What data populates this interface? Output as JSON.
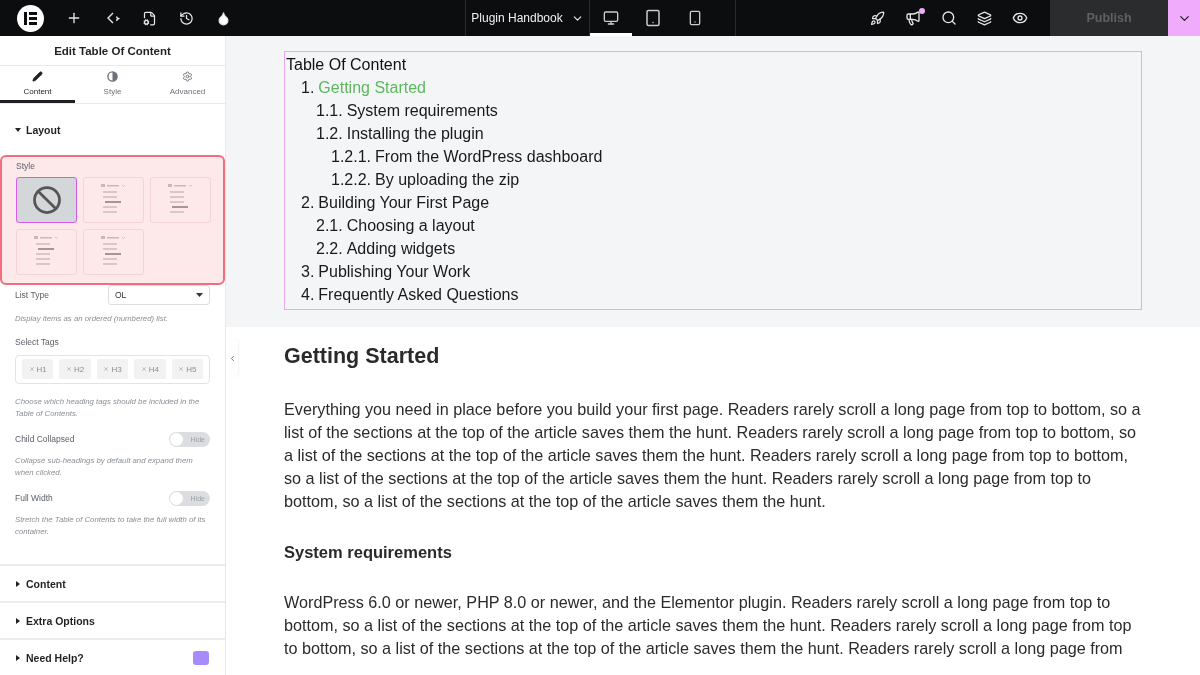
{
  "topbar": {
    "site_name": "Plugin Handbook",
    "devices": [
      {
        "kind": "desktop",
        "selected": true
      },
      {
        "kind": "tablet",
        "selected": false
      },
      {
        "kind": "mobile",
        "selected": false
      }
    ],
    "publish": {
      "label": "Publish",
      "disabled": true
    }
  },
  "panel": {
    "title": "Edit Table Of Content",
    "tabs": [
      {
        "kind": "content",
        "label": "Content",
        "selected": true
      },
      {
        "kind": "style",
        "label": "Style",
        "selected": false
      },
      {
        "kind": "advanced",
        "label": "Advanced",
        "selected": false
      }
    ],
    "layout": {
      "title": "Layout",
      "expanded": true,
      "style_label": "Style",
      "styles": [
        {
          "kind": "none",
          "selected": true
        },
        {
          "kind": "list",
          "selected": false
        },
        {
          "kind": "list",
          "selected": false
        },
        {
          "kind": "list",
          "selected": false
        },
        {
          "kind": "list",
          "selected": false
        }
      ],
      "list_type": {
        "label": "List Type",
        "value": "OL",
        "help": "Display items as an ordered (numbered) list."
      },
      "tags": {
        "label": "Select Tags",
        "items": [
          "H1",
          "H2",
          "H3",
          "H4",
          "H5"
        ],
        "help": "Choose which heading tags should be included in the Table of Contents."
      },
      "toggles": [
        {
          "label": "Child Collapsed",
          "state_label": "Hide",
          "on": false,
          "help": "Collapse sub-headings by default and expand them when clicked."
        },
        {
          "label": "Full Width",
          "state_label": "Hide",
          "on": false,
          "help": "Stretch the Table of Contents to take the full width of its container."
        }
      ]
    },
    "sections": [
      {
        "title": "Content",
        "expanded": false,
        "help_badge": false
      },
      {
        "title": "Extra Options",
        "expanded": false,
        "help_badge": false
      },
      {
        "title": "Need Help?",
        "expanded": false,
        "help_badge": true
      }
    ]
  },
  "toc": {
    "title": "Table Of Content",
    "items": [
      {
        "number": "1.",
        "text": "Getting Started",
        "selected": true,
        "children": [
          {
            "number": "1.1.",
            "text": "System requirements",
            "selected": false
          },
          {
            "number": "1.2.",
            "text": "Installing the plugin",
            "selected": false,
            "children": [
              {
                "number": "1.2.1.",
                "text": "From the WordPress dashboard",
                "selected": false
              },
              {
                "number": "1.2.2.",
                "text": "By uploading the zip",
                "selected": false
              }
            ]
          }
        ]
      },
      {
        "number": "2.",
        "text": "Building Your First Page",
        "selected": false,
        "children": [
          {
            "number": "2.1.",
            "text": "Choosing a layout",
            "selected": false
          },
          {
            "number": "2.2.",
            "text": "Adding widgets",
            "selected": false
          }
        ]
      },
      {
        "number": "3.",
        "text": "Publishing Your Work",
        "selected": false
      },
      {
        "number": "4.",
        "text": "Frequently Asked Questions",
        "selected": false
      }
    ]
  },
  "article": [
    {
      "kind": "h2",
      "text": "Getting Started"
    },
    {
      "kind": "p",
      "text": "Everything you need in place before you build your first page. Readers rarely scroll a long page from top to bottom, so a list of the sections at the top of the article saves them the hunt. Readers rarely scroll a long page from top to bottom, so a list of the sections at the top of the article saves them the hunt. Readers rarely scroll a long page from top to bottom, so a list of the sections at the top of the article saves them the hunt. Readers rarely scroll a long page from top to bottom, so a list of the sections at the top of the article saves them the hunt."
    },
    {
      "kind": "h3",
      "text": "System requirements"
    },
    {
      "kind": "p",
      "text": "WordPress 6.0 or newer, PHP 8.0 or newer, and the Elementor plugin. Readers rarely scroll a long page from top to bottom, so a list of the sections at the top of the article saves them the hunt. Readers rarely scroll a long page from top to bottom, so a list of the sections at the top of the article saves them the hunt. Readers rarely scroll a long page from"
    }
  ]
}
